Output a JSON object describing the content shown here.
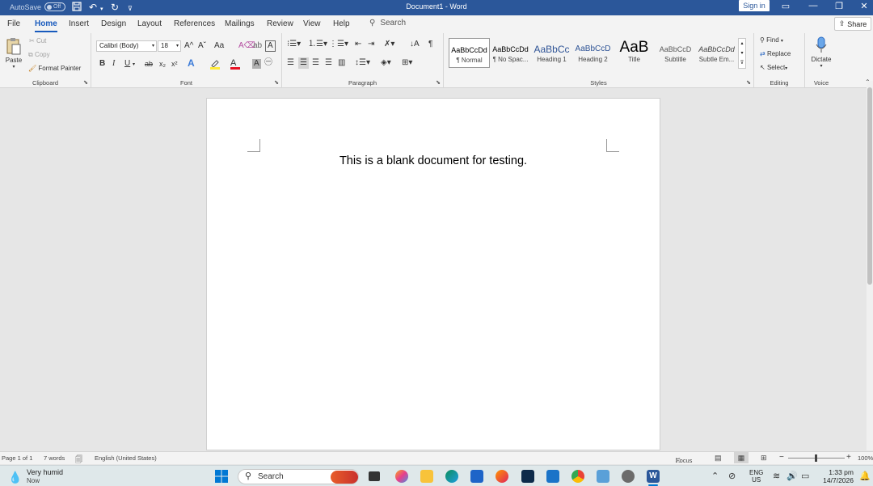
{
  "titlebar": {
    "autosave_label": "AutoSave",
    "autosave_state": "Off",
    "document_title": "Document1  -  Word",
    "signin_label": "Sign in",
    "minimize": "—",
    "restore": "❐",
    "close": "✕"
  },
  "tabs": [
    "File",
    "Home",
    "Insert",
    "Design",
    "Layout",
    "References",
    "Mailings",
    "Review",
    "View",
    "Help"
  ],
  "search": {
    "label": "Search"
  },
  "share": {
    "label": "Share"
  },
  "clipboard": {
    "paste": "Paste",
    "cut": "Cut",
    "copy": "Copy",
    "format_painter": "Format Painter",
    "group_label": "Clipboard"
  },
  "font": {
    "name": "Calibri (Body)",
    "size": "18",
    "grow": "A^",
    "shrink": "Aˇ",
    "change_case": "Aa",
    "bold": "B",
    "italic": "I",
    "underline": "U",
    "strike": "ab",
    "subscript": "x₂",
    "superscript": "x²",
    "group_label": "Font"
  },
  "paragraph": {
    "group_label": "Paragraph"
  },
  "styles": {
    "items": [
      {
        "sample": "AaBbCcDd",
        "name": "¶ Normal"
      },
      {
        "sample": "AaBbCcDd",
        "name": "¶ No Spac..."
      },
      {
        "sample": "AaBbCc",
        "name": "Heading 1"
      },
      {
        "sample": "AaBbCcD",
        "name": "Heading 2"
      },
      {
        "sample": "AaB",
        "name": "Title"
      },
      {
        "sample": "AaBbCcD",
        "name": "Subtitle"
      },
      {
        "sample": "AaBbCcDd",
        "name": "Subtle Em..."
      }
    ],
    "group_label": "Styles"
  },
  "editing": {
    "find": "Find",
    "replace": "Replace",
    "select": "Select",
    "group_label": "Editing"
  },
  "voice": {
    "dictate": "Dictate",
    "group_label": "Voice"
  },
  "document": {
    "text": "This is a blank document for testing."
  },
  "status": {
    "page": "Page 1 of 1",
    "words": "7 words",
    "language": "English (United States)",
    "focus": "Focus",
    "zoom": "100%"
  },
  "taskbar": {
    "weather_title": "Very humid",
    "weather_sub": "Now",
    "search": "Search",
    "lang_top": "ENG",
    "lang_bottom": "US",
    "time": "1:33 pm",
    "date": "14/7/2026"
  },
  "colors": {
    "word_blue": "#2b579a",
    "accent": "#185abd",
    "ribbon_bg": "#f3f3f3"
  }
}
